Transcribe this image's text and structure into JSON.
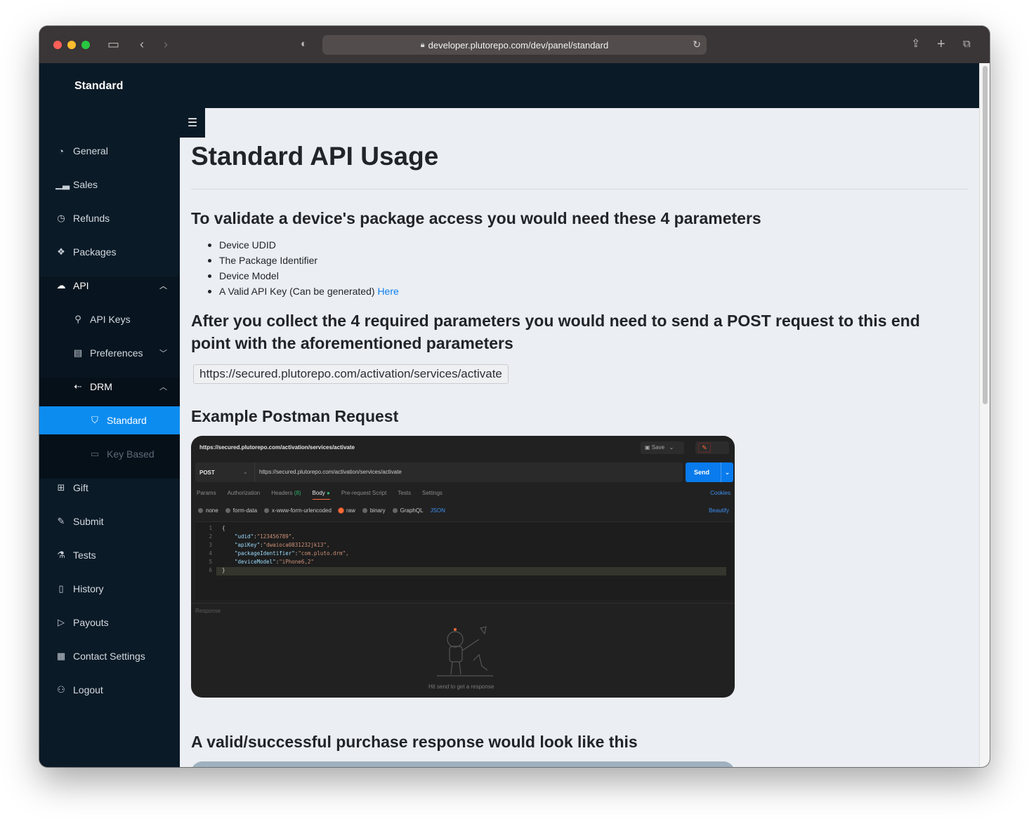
{
  "browser": {
    "url": "developer.plutorepo.com/dev/panel/standard"
  },
  "sidebar": {
    "brand": "Standard",
    "items": [
      {
        "label": "General",
        "icon": "pie-chart-icon"
      },
      {
        "label": "Sales",
        "icon": "bar-chart-icon"
      },
      {
        "label": "Refunds",
        "icon": "history-icon"
      },
      {
        "label": "Packages",
        "icon": "dropbox-icon"
      },
      {
        "label": "API",
        "icon": "cloud-icon"
      },
      {
        "label": "API Keys",
        "icon": "key-icon"
      },
      {
        "label": "Preferences",
        "icon": "document-icon"
      },
      {
        "label": "DRM",
        "icon": "drm-icon"
      },
      {
        "label": "Standard",
        "icon": "shield-icon"
      },
      {
        "label": "Key Based",
        "icon": "monitor-icon"
      },
      {
        "label": "Gift",
        "icon": "gift-icon"
      },
      {
        "label": "Submit",
        "icon": "pencil-icon"
      },
      {
        "label": "Tests",
        "icon": "flask-icon"
      },
      {
        "label": "History",
        "icon": "file-icon"
      },
      {
        "label": "Payouts",
        "icon": "send-icon"
      },
      {
        "label": "Contact Settings",
        "icon": "contact-icon"
      },
      {
        "label": "Logout",
        "icon": "logout-icon"
      }
    ]
  },
  "content": {
    "title": "Standard API Usage",
    "section1": "To validate a device's package access you would need these 4 parameters",
    "params": [
      "Device UDID",
      "The Package Identifier",
      "Device Model",
      "A Valid API Key (Can be generated)"
    ],
    "here_link": "Here",
    "section2": "After you collect the 4 required parameters you would need to send a POST request to this end point with the aforementioned parameters",
    "endpoint": "https://secured.plutorepo.com/activation/services/activate",
    "section3": "Example Postman Request",
    "section4": "A valid/successful purchase response would look like this"
  },
  "postman": {
    "tab_title": "https://secured.plutorepo.com/activation/services/activate",
    "save": "Save",
    "method": "POST",
    "url": "https://secured.plutorepo.com/activation/services/activate",
    "send": "Send",
    "tabs": [
      "Params",
      "Authorization",
      "Headers",
      "Body",
      "Pre-request Script",
      "Tests",
      "Settings"
    ],
    "headers_count": "(8)",
    "cookies": "Cookies",
    "body_types": [
      "none",
      "form-data",
      "x-www-form-urlencoded",
      "raw",
      "binary",
      "GraphQL"
    ],
    "format": "JSON",
    "beautify": "Beautify",
    "code_lines": [
      {
        "n": "1",
        "text": "{"
      },
      {
        "n": "2",
        "key": "\"udid\"",
        "val": "\"123456789\","
      },
      {
        "n": "3",
        "key": "\"apiKey\"",
        "val": "\"dwaioca0831232jk13\","
      },
      {
        "n": "4",
        "key": "\"packageIdentifier\"",
        "val": "\"com.pluto.drm\","
      },
      {
        "n": "5",
        "key": "\"deviceModel\"",
        "val": "\"iPhone6,2\""
      },
      {
        "n": "6",
        "text": "}"
      }
    ],
    "response": "Response",
    "hint": "Hit send to get a response"
  }
}
